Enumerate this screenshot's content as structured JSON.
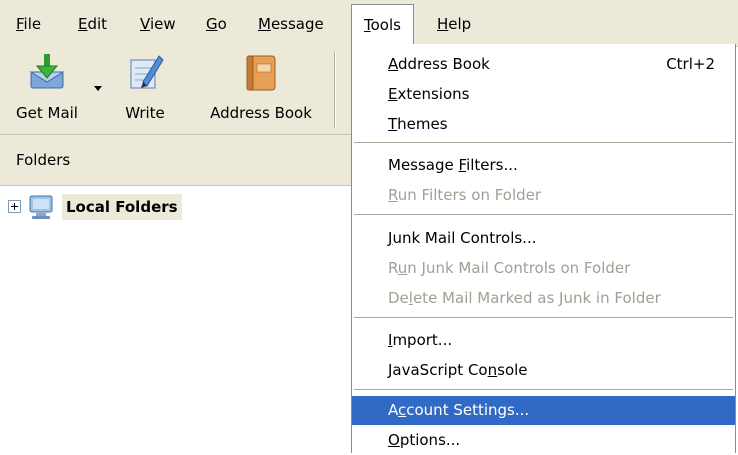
{
  "menubar": {
    "items": [
      {
        "label": "File",
        "mnemonic": "F",
        "rest": "ile"
      },
      {
        "label": "Edit",
        "mnemonic": "E",
        "rest": "dit"
      },
      {
        "label": "View",
        "mnemonic": "V",
        "rest": "iew"
      },
      {
        "label": "Go",
        "mnemonic": "G",
        "rest": "o"
      },
      {
        "label": "Message",
        "mnemonic": "M",
        "rest": "essage"
      },
      {
        "label": "Tools",
        "mnemonic": "T",
        "rest": "ools"
      },
      {
        "label": "Help",
        "mnemonic": "H",
        "rest": "elp"
      }
    ]
  },
  "toolbar": {
    "get_mail": "Get Mail",
    "write": "Write",
    "address_book": "Address Book"
  },
  "folders": {
    "header": "Folders",
    "tree": [
      {
        "label": "Local Folders",
        "icon": "computer-icon"
      }
    ]
  },
  "tools_menu": {
    "items": [
      {
        "pre": "",
        "mn": "A",
        "post": "ddress Book",
        "shortcut": "Ctrl+2",
        "enabled": true
      },
      {
        "pre": "",
        "mn": "E",
        "post": "xtensions",
        "shortcut": "",
        "enabled": true
      },
      {
        "pre": "",
        "mn": "T",
        "post": "hemes",
        "shortcut": "",
        "enabled": true
      },
      {
        "pre": "Message ",
        "mn": "F",
        "post": "ilters...",
        "shortcut": "",
        "enabled": true
      },
      {
        "pre": "",
        "mn": "R",
        "post": "un Filters on Folder",
        "shortcut": "",
        "enabled": false
      },
      {
        "pre": "",
        "mn": "J",
        "post": "unk Mail Controls...",
        "shortcut": "",
        "enabled": true
      },
      {
        "pre": "R",
        "mn": "u",
        "post": "n Junk Mail Controls on Folder",
        "shortcut": "",
        "enabled": false
      },
      {
        "pre": "De",
        "mn": "l",
        "post": "ete Mail Marked as Junk in Folder",
        "shortcut": "",
        "enabled": false
      },
      {
        "pre": "",
        "mn": "I",
        "post": "mport...",
        "shortcut": "",
        "enabled": true
      },
      {
        "pre": "JavaScript Co",
        "mn": "n",
        "post": "sole",
        "shortcut": "",
        "enabled": true
      },
      {
        "pre": "A",
        "mn": "c",
        "post": "count Settings...",
        "shortcut": "",
        "enabled": true,
        "highlighted": true
      },
      {
        "pre": "",
        "mn": "O",
        "post": "ptions...",
        "shortcut": "",
        "enabled": true
      }
    ]
  },
  "colors": {
    "menu_highlight": "#316ac5",
    "chrome": "#ece9d8",
    "disabled_text": "#a39e93"
  }
}
